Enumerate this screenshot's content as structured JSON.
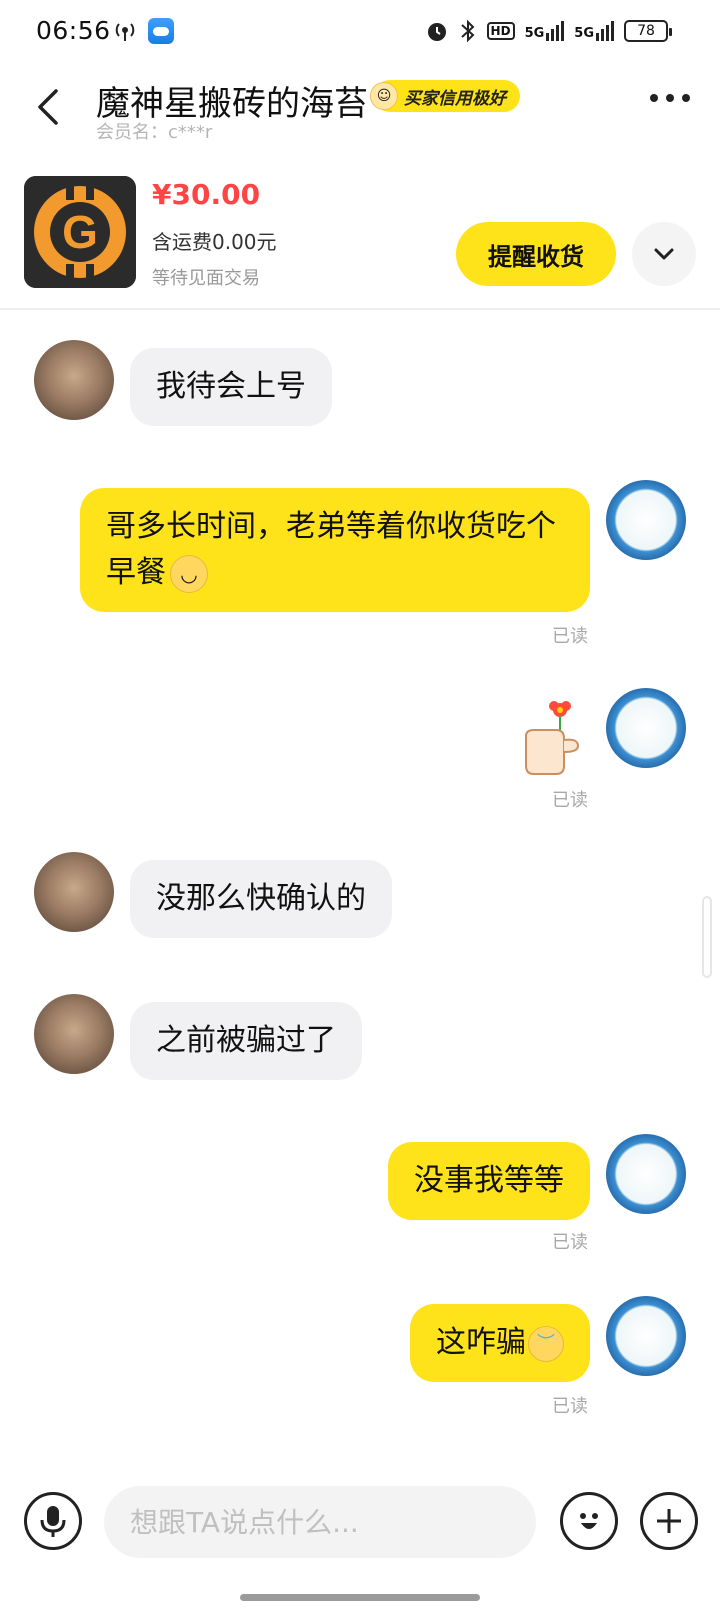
{
  "status_bar": {
    "time": "06:56",
    "network_a": "5G",
    "network_b": "5G",
    "battery": "78",
    "icons": [
      "hotspot-icon",
      "weather-app-icon",
      "alarm-icon",
      "bluetooth-icon",
      "hd-icon",
      "signal-icon"
    ]
  },
  "header": {
    "title": "魔神星搬砖的海苔",
    "badge": "买家信用极好",
    "member": "会员名：c***r"
  },
  "product": {
    "image_letter": "G",
    "price": "¥30.00",
    "shipping": "含运费0.00元",
    "status": "等待见面交易",
    "remind_button": "提醒收货"
  },
  "messages": [
    {
      "side": "in",
      "text": "我待会上号"
    },
    {
      "side": "out",
      "text": "哥多长时间，老弟等着你收货吃个早餐",
      "read": "已读",
      "emoji": "relieved-face-emoji"
    },
    {
      "side": "out",
      "sticker": "thumb-flower-sticker",
      "read": "已读"
    },
    {
      "side": "in",
      "text": "没那么快确认的"
    },
    {
      "side": "in",
      "text": "之前被骗过了"
    },
    {
      "side": "out",
      "text": "没事我等等",
      "read": "已读"
    },
    {
      "side": "out",
      "text": "这咋骗",
      "read": "已读",
      "emoji": "downcast-sweat-emoji"
    }
  ],
  "input": {
    "placeholder": "想跟TA说点什么..."
  },
  "colors": {
    "accent": "#ffe31a",
    "price": "#ff4444",
    "bubble_in": "#f1f1f3",
    "read_text": "#a8a8a8"
  }
}
